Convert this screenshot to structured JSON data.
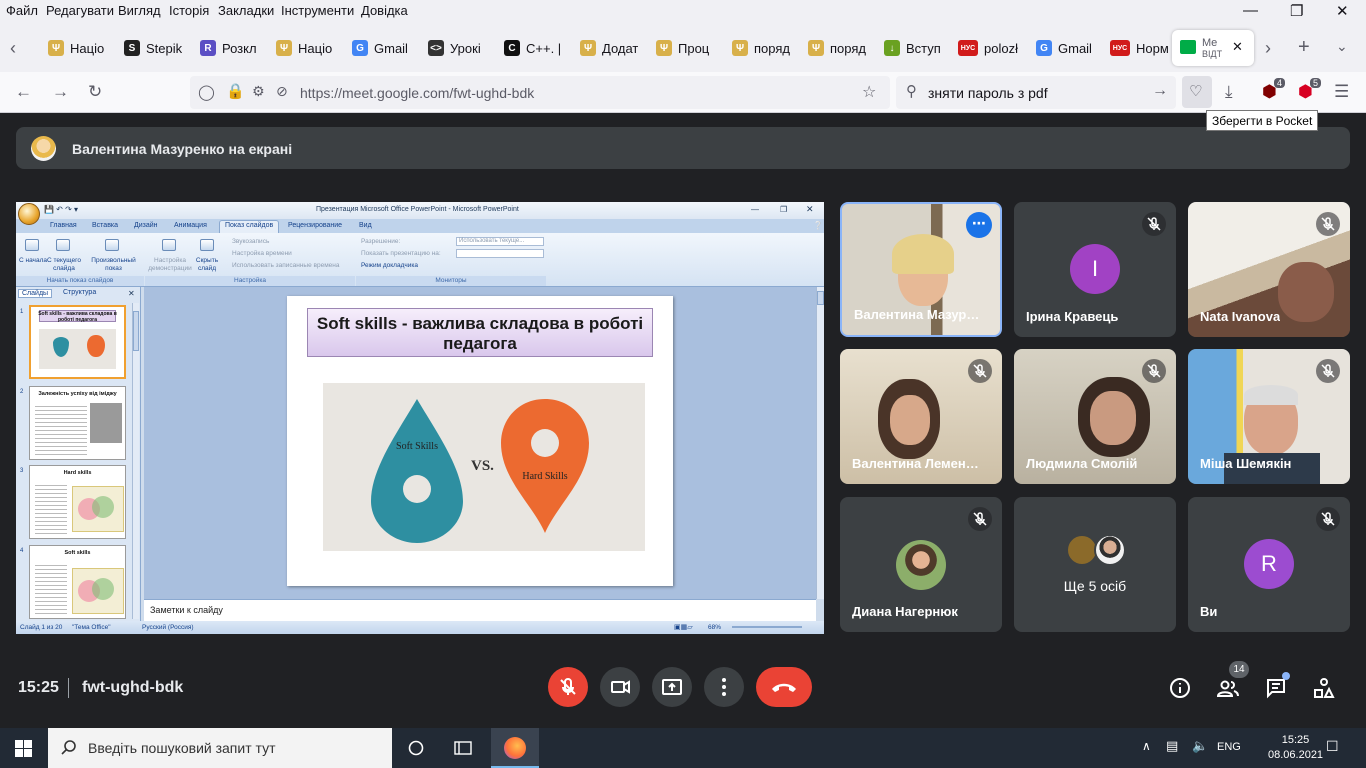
{
  "menu": [
    "Файл",
    "Редагувати",
    "Вигляд",
    "Історія",
    "Закладки",
    "Інструменти",
    "Довідка"
  ],
  "tabs": [
    {
      "label": "Націо",
      "icon": "trident-icon"
    },
    {
      "label": "Stepik",
      "icon": "stepik-icon"
    },
    {
      "label": "Розкл",
      "icon": "schedule-icon"
    },
    {
      "label": "Націо",
      "icon": "trident-icon"
    },
    {
      "label": "Gmail",
      "icon": "google-icon"
    },
    {
      "label": "Урокі",
      "icon": "code-icon"
    },
    {
      "label": "C++. |",
      "icon": "cpp-icon"
    },
    {
      "label": "Додат",
      "icon": "trident-icon"
    },
    {
      "label": "Проц",
      "icon": "trident-icon"
    },
    {
      "label": "поряд",
      "icon": "trident-icon"
    },
    {
      "label": "поряд",
      "icon": "trident-icon"
    },
    {
      "label": "Вступ",
      "icon": "download-icon"
    },
    {
      "label": "polozł",
      "icon": "nus-icon"
    },
    {
      "label": "Gmail",
      "icon": "google-icon"
    },
    {
      "label": "Норм",
      "icon": "nus-icon"
    }
  ],
  "active_tab": {
    "line1": "Me",
    "line2": "ВІДТ"
  },
  "url": "https://meet.google.com/fwt-ughd-bdk",
  "search": "зняти пароль з pdf",
  "badges": {
    "ublock": "4",
    "ext": "5"
  },
  "pocket_tooltip": "Зберегти в Pocket",
  "presenter": "Валентина Мазуренко на екрані",
  "ppt": {
    "window_title": "Презентация Microsoft Office PowerPoint - Microsoft PowerPoint",
    "ribbon_tabs": [
      "Главная",
      "Вставка",
      "Дизайн",
      "Анимация",
      "Показ слайдов",
      "Рецензирование",
      "Вид"
    ],
    "buttons": {
      "from_start": "С начала",
      "from_current": "С текущего слайда",
      "custom": "Произвольный показ",
      "setup": "Настройка демонстрации",
      "hide": "Скрыть слайд",
      "record": "Звукозапись",
      "rehearse": "Настройка времени",
      "use_timings": "Использовать записанные времена",
      "resolution": "Разрешение:",
      "resolution_value": "Использовать текуще...",
      "show_on": "Показать презентацию на:",
      "presenter_view": "Режим докладчика"
    },
    "groups": [
      "Начать показ слайдов",
      "Настройка",
      "Мониторы"
    ],
    "pane_tabs": [
      "Слайды",
      "Структура"
    ],
    "thumbs": [
      {
        "num": "1",
        "title": "Soft skills - важлива складова в роботі педагога"
      },
      {
        "num": "2",
        "title": "Залежність успіху від іміджу"
      },
      {
        "num": "3",
        "title": "Hard skills"
      },
      {
        "num": "4",
        "title": "Soft skills"
      }
    ],
    "slide_title": "Soft skills - важлива складова в роботі педагога",
    "soft_label": "Soft Skills",
    "hard_label": "Hard Skills",
    "vs_label": "VS.",
    "notes": "Заметки к слайду",
    "status": {
      "slide": "Слайд 1 из 20",
      "theme": "\"Тема Office\"",
      "lang": "Русский (Россия)",
      "zoom": "68%"
    }
  },
  "participants": [
    {
      "name": "Валентина Мазур…",
      "type": "video",
      "pinned": true
    },
    {
      "name": "Ірина Кравець",
      "type": "initial",
      "initial": "І",
      "color": "#a142c4"
    },
    {
      "name": "Nata Ivanova",
      "type": "video"
    },
    {
      "name": "Валентина Лемен…",
      "type": "video"
    },
    {
      "name": "Людмила Смолій",
      "type": "video"
    },
    {
      "name": "Міша Шемякін",
      "type": "video"
    },
    {
      "name": "Диана Нагернюк",
      "type": "avatar"
    },
    {
      "name": "Ще 5 осіб",
      "type": "others"
    },
    {
      "name": "Ви",
      "type": "initial",
      "initial": "R",
      "color": "#9c4cd0"
    }
  ],
  "meeting": {
    "time": "15:25",
    "code": "fwt-ughd-bdk",
    "people_count": "14"
  },
  "taskbar": {
    "search_placeholder": "Введіть пошуковий запит тут",
    "lang": "ENG",
    "time": "15:25",
    "date": "08.06.2021"
  }
}
